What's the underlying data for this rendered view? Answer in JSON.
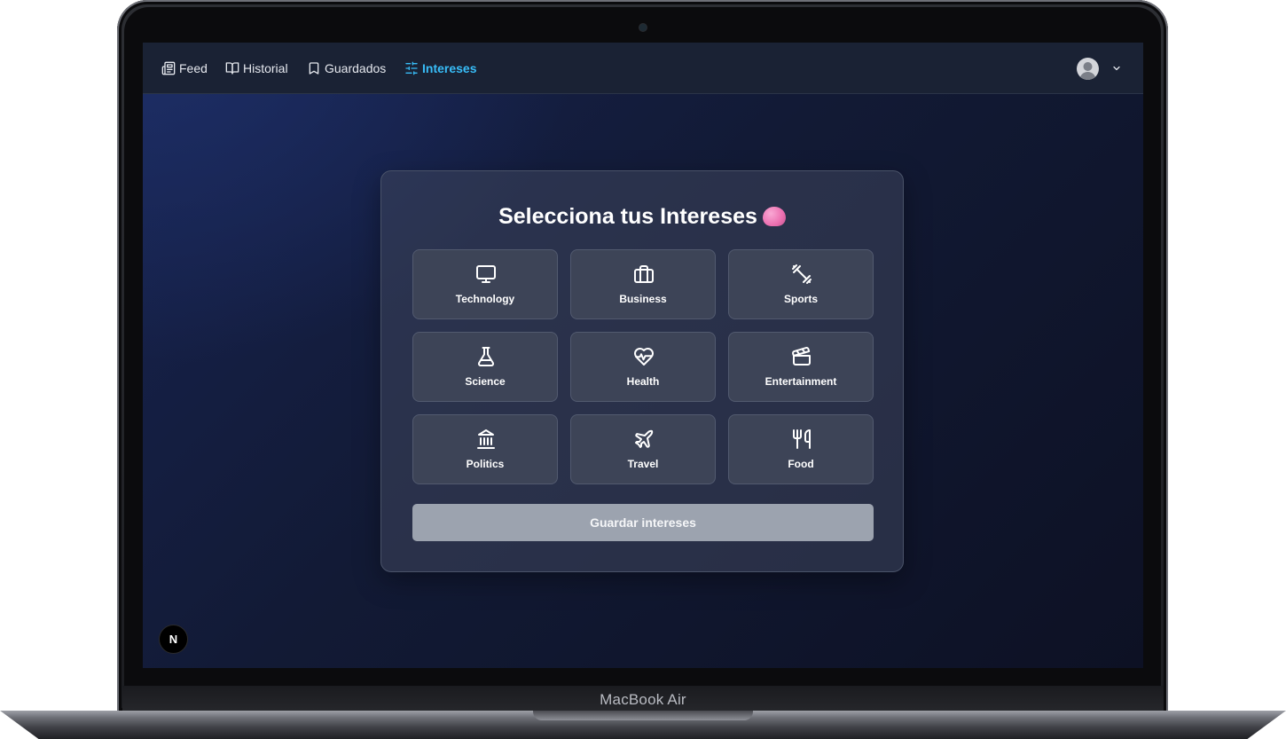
{
  "device": {
    "label": "MacBook Air"
  },
  "nav": {
    "items": [
      {
        "label": "Feed",
        "icon": "newspaper-icon",
        "active": false
      },
      {
        "label": "Historial",
        "icon": "book-open-icon",
        "active": false
      },
      {
        "label": "Guardados",
        "icon": "bookmark-icon",
        "active": false
      },
      {
        "label": "Intereses",
        "icon": "sliders-icon",
        "active": true
      }
    ],
    "active_color": "#38bdf8",
    "user_menu": {
      "avatar_icon": "user-avatar-icon",
      "chevron_icon": "chevron-down-icon"
    }
  },
  "interests": {
    "title": "Selecciona tus Intereses",
    "title_emoji": "brain-emoji",
    "categories": [
      {
        "label": "Technology",
        "icon": "monitor-icon"
      },
      {
        "label": "Business",
        "icon": "briefcase-icon"
      },
      {
        "label": "Sports",
        "icon": "dumbbell-icon"
      },
      {
        "label": "Science",
        "icon": "flask-icon"
      },
      {
        "label": "Health",
        "icon": "heart-pulse-icon"
      },
      {
        "label": "Entertainment",
        "icon": "clapperboard-icon"
      },
      {
        "label": "Politics",
        "icon": "landmark-icon"
      },
      {
        "label": "Travel",
        "icon": "plane-icon"
      },
      {
        "label": "Food",
        "icon": "utensils-icon"
      }
    ],
    "save_label": "Guardar intereses"
  },
  "dev_badge": {
    "label": "N"
  }
}
